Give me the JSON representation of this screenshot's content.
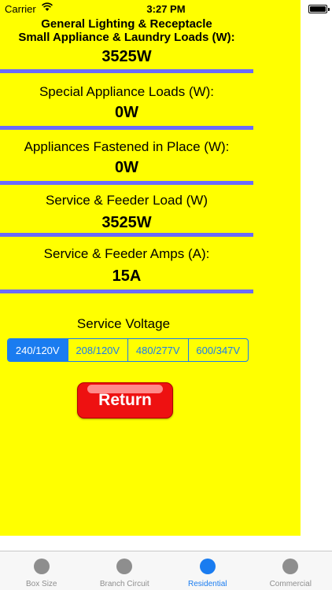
{
  "status_bar": {
    "carrier": "Carrier",
    "time": "3:27 PM",
    "wifi_icon": "wifi-icon",
    "battery_icon": "battery-icon"
  },
  "sections": {
    "general": {
      "label_line1": "General Lighting & Receptacle",
      "label_line2": "Small Appliance & Laundry Loads (W):",
      "value": "3525W"
    },
    "special": {
      "label": "Special Appliance Loads (W):",
      "value": "0W"
    },
    "fastened": {
      "label": "Appliances Fastened in Place (W):",
      "value": "0W"
    },
    "service_load": {
      "label": "Service & Feeder Load (W)",
      "value": "3525W"
    },
    "service_amps": {
      "label": "Service & Feeder Amps (A):",
      "value": "15A"
    }
  },
  "voltage": {
    "title": "Service Voltage",
    "options": [
      "240/120V",
      "208/120V",
      "480/277V",
      "600/347V"
    ],
    "selected": "240/120V"
  },
  "return_button": {
    "label": "Return"
  },
  "tab_bar": {
    "tabs": [
      {
        "label": "Box Size",
        "active": false
      },
      {
        "label": "Branch Circuit",
        "active": false
      },
      {
        "label": "Residential",
        "active": true
      },
      {
        "label": "Commercial",
        "active": false
      }
    ]
  },
  "colors": {
    "panel_background": "#ffff00",
    "divider": "#6b6bff",
    "accent": "#1a7cf0",
    "return_button": "#ee1111"
  }
}
